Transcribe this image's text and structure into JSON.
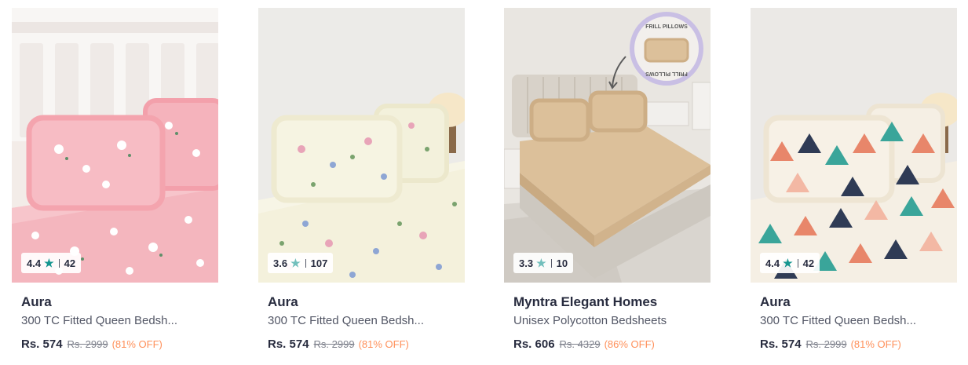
{
  "products": [
    {
      "rating": "4.4",
      "rating_count": "42",
      "brand": "Aura",
      "description": "300 TC Fitted Queen Bedsh...",
      "price": "Rs. 574",
      "mrp": "Rs. 2999",
      "discount": "(81% OFF)"
    },
    {
      "rating": "3.6",
      "rating_count": "107",
      "brand": "Aura",
      "description": "300 TC Fitted Queen Bedsh...",
      "price": "Rs. 574",
      "mrp": "Rs. 2999",
      "discount": "(81% OFF)"
    },
    {
      "rating": "3.3",
      "rating_count": "10",
      "brand": "Myntra Elegant Homes",
      "description": "Unisex Polycotton Bedsheets",
      "price": "Rs. 606",
      "mrp": "Rs. 4329",
      "discount": "(86% OFF)",
      "image_badge_top": "FRILL PILLOWS",
      "image_badge_bottom": "FRILL PILLOWS"
    },
    {
      "rating": "4.4",
      "rating_count": "42",
      "brand": "Aura",
      "description": "300 TC Fitted Queen Bedsh...",
      "price": "Rs. 574",
      "mrp": "Rs. 2999",
      "discount": "(81% OFF)"
    }
  ],
  "icons": {
    "rating_star": "star-icon"
  },
  "colors": {
    "star_high": "#14958f",
    "star_low": "#72bfbc",
    "discount": "#ff905a",
    "brand_text": "#282c3f"
  }
}
